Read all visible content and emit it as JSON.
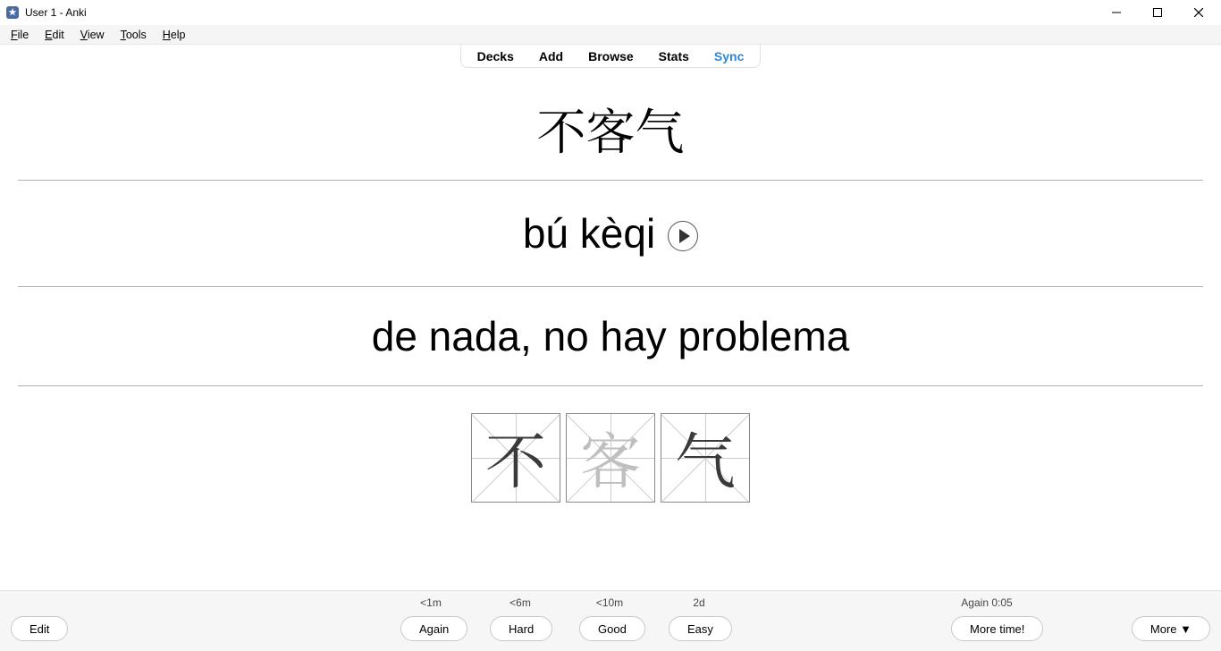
{
  "window": {
    "title": "User 1 - Anki"
  },
  "menu": {
    "file": {
      "u": "F",
      "rest": "ile"
    },
    "edit": {
      "u": "E",
      "rest": "dit"
    },
    "view": {
      "u": "V",
      "rest": "iew"
    },
    "tools": {
      "u": "T",
      "rest": "ools"
    },
    "help": {
      "u": "H",
      "rest": "elp"
    }
  },
  "nav": {
    "decks": "Decks",
    "add": "Add",
    "browse": "Browse",
    "stats": "Stats",
    "sync": "Sync"
  },
  "card": {
    "hanzi": "不客气",
    "pinyin": "bú kèqi",
    "meaning": "de nada, no hay problema",
    "stroke_chars": [
      "不",
      "客",
      "气"
    ]
  },
  "answers": {
    "again": {
      "time": "<1m",
      "label": "Again"
    },
    "hard": {
      "time": "<6m",
      "label": "Hard"
    },
    "good": {
      "time": "<10m",
      "label": "Good"
    },
    "easy": {
      "time": "2d",
      "label": "Easy"
    }
  },
  "footer": {
    "edit": "Edit",
    "again_timer": "Again 0:05",
    "more_time": "More time!",
    "more": "More ▼"
  }
}
